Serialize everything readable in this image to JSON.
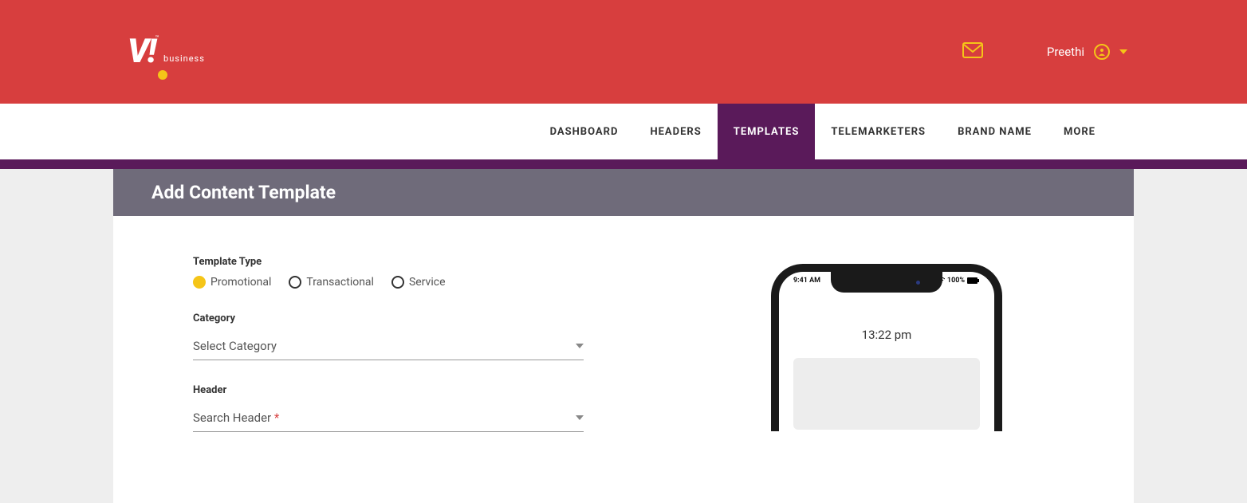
{
  "header": {
    "logo_text": "V!",
    "logo_sub": "business",
    "user_name": "Preethi"
  },
  "nav": {
    "items": [
      "DASHBOARD",
      "HEADERS",
      "TEMPLATES",
      "TELEMARKETERS",
      "BRAND NAME",
      "MORE"
    ],
    "active_index": 2
  },
  "panel": {
    "title": "Add Content Template"
  },
  "form": {
    "template_type_label": "Template Type",
    "options": [
      "Promotional",
      "Transactional",
      "Service"
    ],
    "selected_option_index": 0,
    "category_label": "Category",
    "category_placeholder": "Select Category",
    "header_label": "Header",
    "header_placeholder": "Search Header",
    "asterisk": "*"
  },
  "phone": {
    "status_time": "9:41 AM",
    "status_batt": "100%",
    "timestamp": "13:22 pm"
  }
}
